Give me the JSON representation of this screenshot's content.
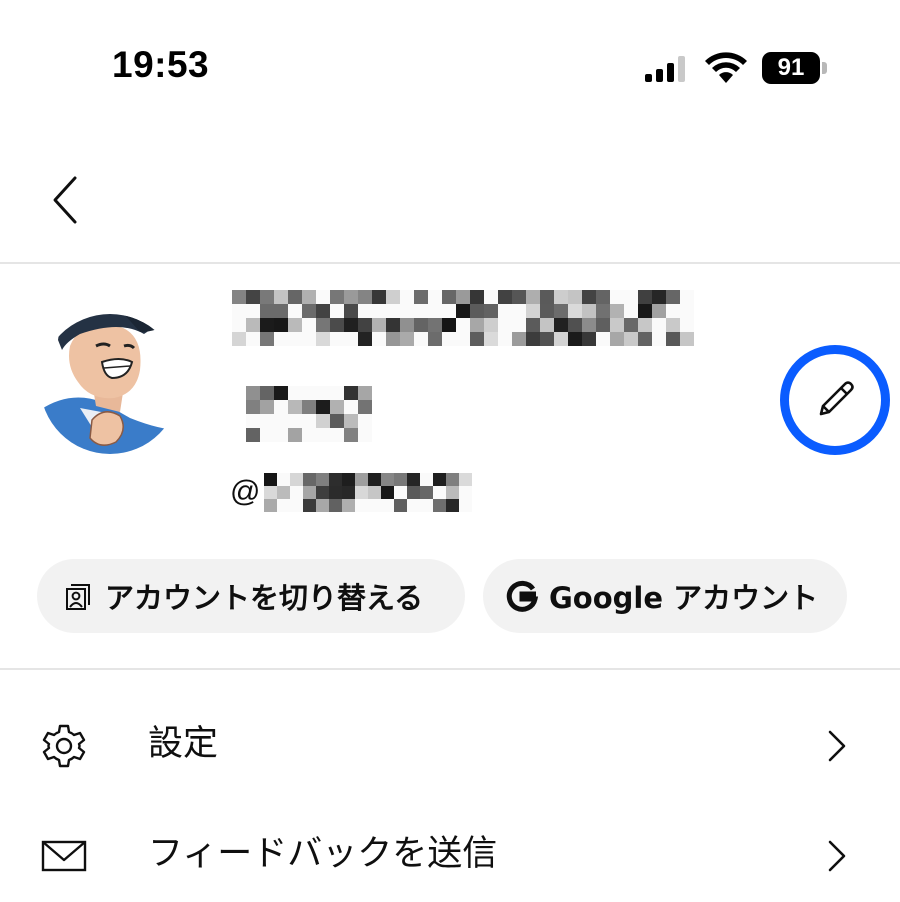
{
  "status_bar": {
    "time": "19:53",
    "battery_level": "91",
    "icons": [
      "signal-icon",
      "wifi-icon",
      "battery-icon"
    ]
  },
  "nav": {
    "back_icon": "chevron-left-icon"
  },
  "profile": {
    "display_name_pixelated": true,
    "handle_prefix": "@",
    "edit_icon": "pencil-icon",
    "accent_color": "#0a5cff"
  },
  "chips": {
    "switch_account": {
      "label": "アカウントを切り替える",
      "icon": "switch-account-icon"
    },
    "google_account": {
      "label": "Google アカウント",
      "icon": "google-g-icon"
    }
  },
  "menu": {
    "items": [
      {
        "label": "設定",
        "icon": "gear-icon"
      },
      {
        "label": "フィードバックを送信",
        "icon": "mail-icon"
      }
    ]
  }
}
